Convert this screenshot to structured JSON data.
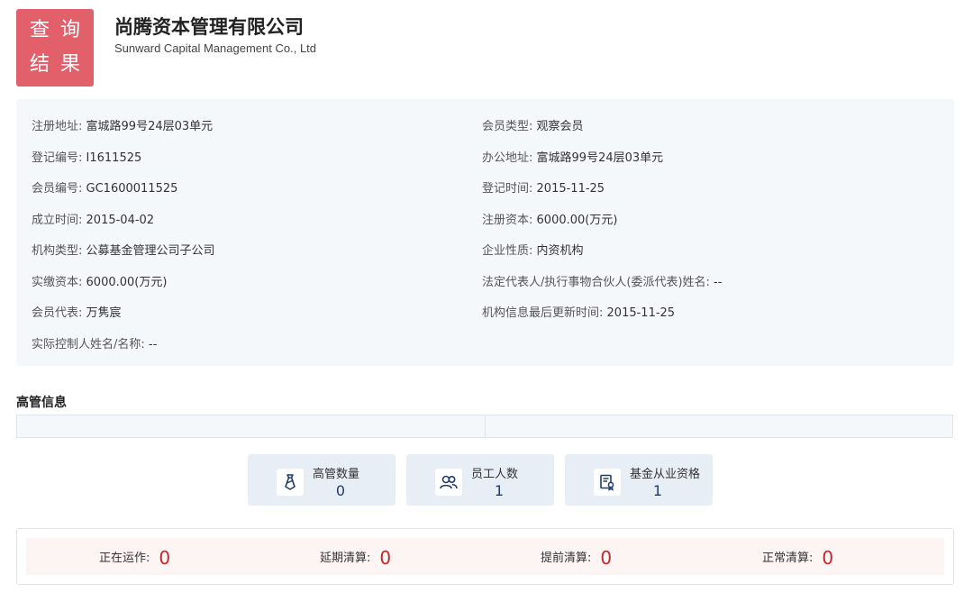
{
  "badge": {
    "line1": "查询",
    "line2": "结果"
  },
  "company": {
    "name_cn": "尚腾资本管理有限公司",
    "name_en": "Sunward Capital Management Co., Ltd"
  },
  "info": {
    "left": [
      {
        "key": "注册地址:",
        "value": "富城路99号24层03单元"
      },
      {
        "key": "登记编号:",
        "value": "I1611525"
      },
      {
        "key": "会员编号:",
        "value": "GC1600011525"
      },
      {
        "key": "成立时间:",
        "value": "2015-04-02"
      },
      {
        "key": "机构类型:",
        "value": "公募基金管理公司子公司"
      },
      {
        "key": "实缴资本:",
        "value": "6000.00(万元)"
      },
      {
        "key": "会员代表:",
        "value": "万隽宸"
      },
      {
        "key": "实际控制人姓名/名称:",
        "value": "--"
      }
    ],
    "right": [
      {
        "key": "会员类型:",
        "value": "观察会员"
      },
      {
        "key": "办公地址:",
        "value": "富城路99号24层03单元"
      },
      {
        "key": "登记时间:",
        "value": "2015-11-25"
      },
      {
        "key": "注册资本:",
        "value": "6000.00(万元)"
      },
      {
        "key": "企业性质:",
        "value": "内资机构"
      },
      {
        "key": "法定代表人/执行事物合伙人(委派代表)姓名:",
        "value": "--"
      },
      {
        "key": "机构信息最后更新时间:",
        "value": "2015-11-25"
      }
    ]
  },
  "executives": {
    "title": "高管信息"
  },
  "stats": [
    {
      "label": "高管数量",
      "value": "0",
      "icon": "tie-icon"
    },
    {
      "label": "员工人数",
      "value": "1",
      "icon": "people-icon"
    },
    {
      "label": "基金从业资格",
      "value": "1",
      "icon": "certificate-icon"
    }
  ],
  "status": [
    {
      "label": "正在运作:",
      "value": "0"
    },
    {
      "label": "延期清算:",
      "value": "0"
    },
    {
      "label": "提前清算:",
      "value": "0"
    },
    {
      "label": "正常清算:",
      "value": "0"
    }
  ],
  "colors": {
    "badge": "#e2606a",
    "panel": "#f5f8fb",
    "stat_value": "#1f3c6e",
    "status_number": "#c0282d"
  }
}
